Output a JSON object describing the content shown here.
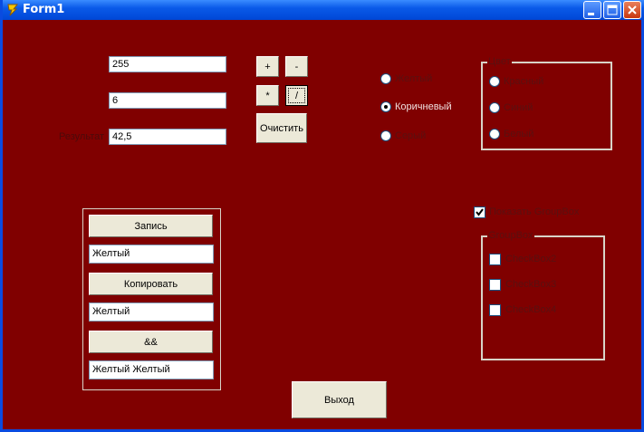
{
  "window": {
    "title": "Form1"
  },
  "calc": {
    "operand1": "255",
    "operand2": "6",
    "result_label": "Результат",
    "result": "42,5",
    "plus_label": "+",
    "minus_label": "-",
    "multiply_label": "*",
    "divide_label": "/",
    "clear_label": "Очистить"
  },
  "radios": [
    {
      "label": "Желтый",
      "checked": false
    },
    {
      "label": "Коричневый",
      "checked": true
    },
    {
      "label": "Серый",
      "checked": false
    }
  ],
  "color_group": {
    "caption": "Цвет",
    "items": [
      "Красный",
      "Синий",
      "Белый"
    ]
  },
  "show_groupbox": {
    "label": "Показать GroupBox",
    "checked": true
  },
  "groupbox": {
    "caption": "GroupBox",
    "items": [
      "CheckBox2",
      "CheckBox3",
      "CheckBox4"
    ]
  },
  "panel": {
    "write_label": "Запись",
    "write_value": "Желтый",
    "copy_label": "Копировать",
    "copy_value": "Желтый",
    "concat_label": "&&",
    "concat_value": "Желтый Желтый"
  },
  "exit_label": "Выход",
  "colors": {
    "form_bg": "#800000",
    "titlebar": "#0a5ae8",
    "button_face": "#ece9d8"
  }
}
